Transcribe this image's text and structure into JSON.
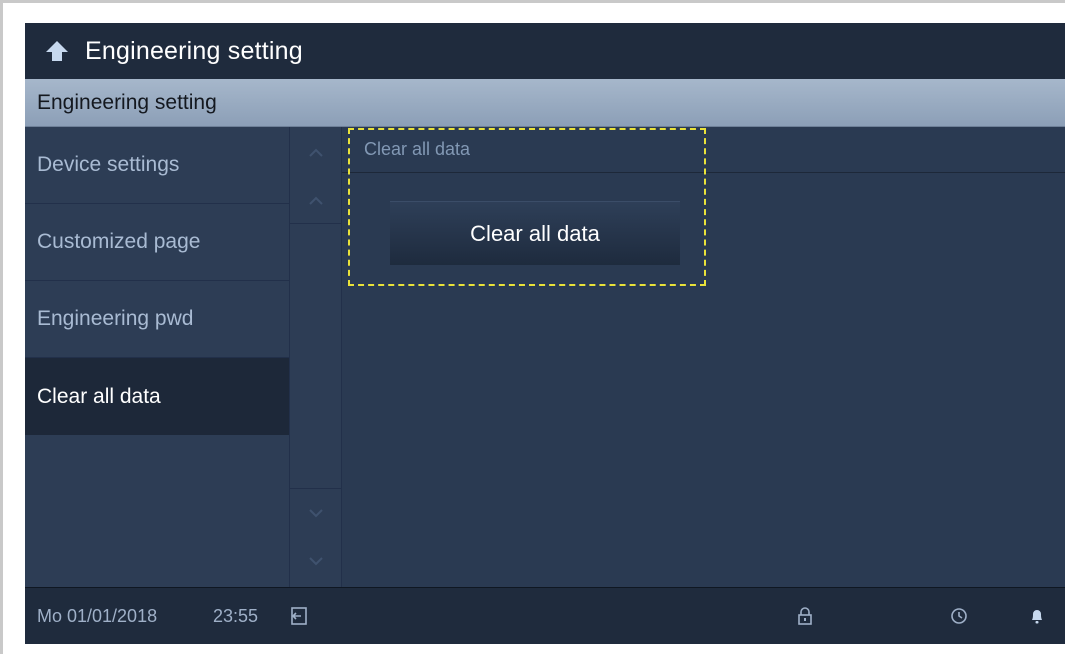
{
  "titlebar": {
    "title": "Engineering setting",
    "back_icon": "back-arrow-icon"
  },
  "section": {
    "header": "Engineering setting"
  },
  "menu": {
    "items": [
      {
        "label": "Device settings"
      },
      {
        "label": "Customized page"
      },
      {
        "label": "Engineering pwd"
      },
      {
        "label": "Clear all data",
        "selected": true
      }
    ]
  },
  "content": {
    "header": "Clear all data",
    "button_label": "Clear all data"
  },
  "statusbar": {
    "date": "Mo 01/01/2018",
    "time": "23:55",
    "icons": [
      "logout-icon",
      "lock-icon",
      "history-icon",
      "bell-icon"
    ]
  },
  "colors": {
    "screen_bg": "#2a3a52",
    "titlebar_bg": "#1f2b3d",
    "header_bg": "#9aaec4",
    "selected_bg": "#1d2839",
    "highlight": "#e9e23a"
  }
}
